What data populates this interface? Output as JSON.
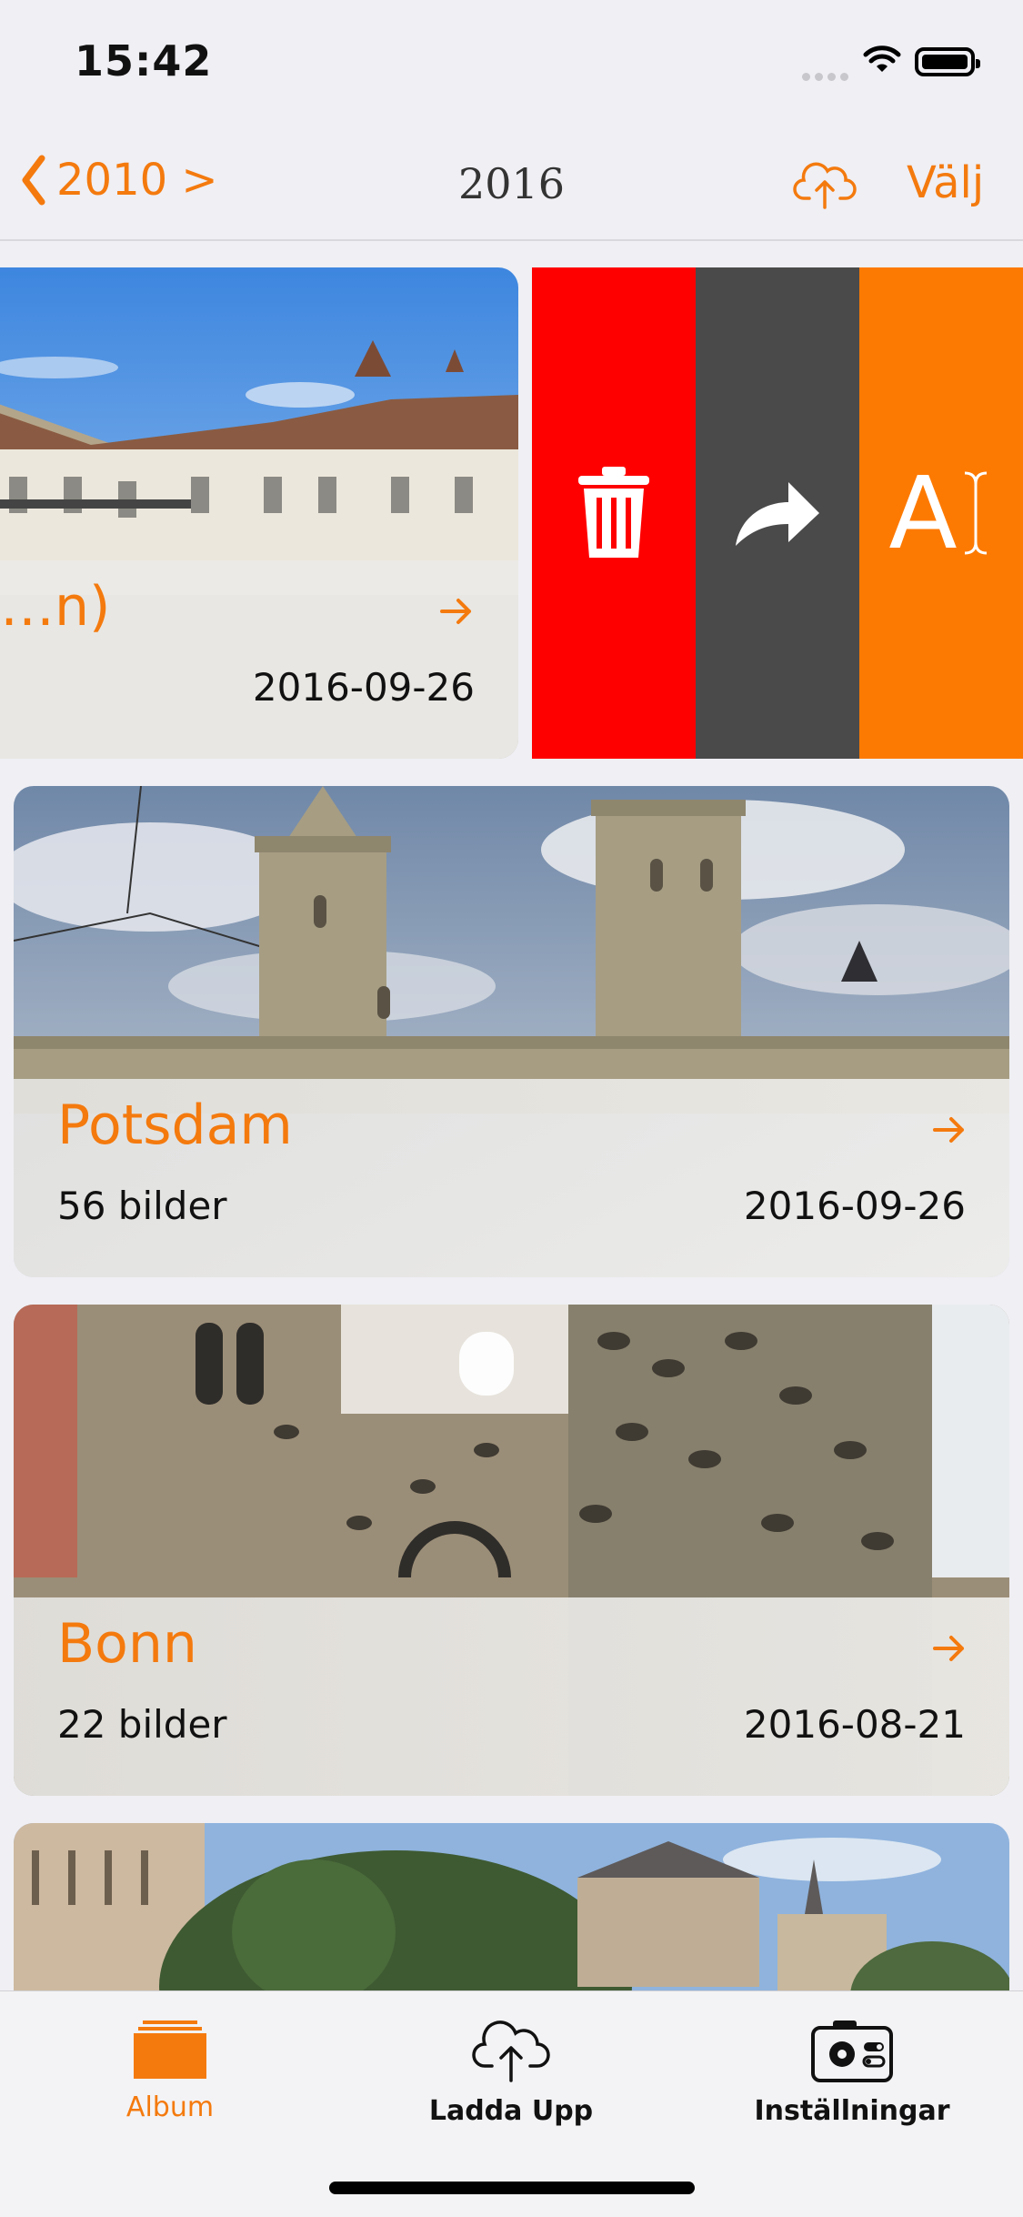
{
  "status_bar": {
    "time": "15:42"
  },
  "nav": {
    "back_label": "2010 >",
    "title": "2016",
    "upload_icon": "cloud-upload-icon",
    "select_label": "Välj"
  },
  "albums": [
    {
      "title": "…n)",
      "count": "",
      "date": "2016-09-26"
    },
    {
      "title": "Potsdam",
      "count": "56 bilder",
      "date": "2016-09-26"
    },
    {
      "title": "Bonn",
      "count": "22 bilder",
      "date": "2016-08-21"
    }
  ],
  "swipe_actions": {
    "delete_icon": "trash-icon",
    "share_icon": "share-arrow-icon",
    "rename_label": "A",
    "colors": {
      "delete": "#fe0000",
      "share": "#4a4a4a",
      "rename": "#fd7a02"
    }
  },
  "tabbar": {
    "tabs": [
      {
        "label": "Album",
        "icon": "album-stack-icon",
        "active": true
      },
      {
        "label": "Ladda Upp",
        "icon": "cloud-upload-icon",
        "active": false
      },
      {
        "label": "Inställningar",
        "icon": "settings-camera-icon",
        "active": false
      }
    ]
  },
  "colors": {
    "accent": "#f47a0e",
    "background": "#efeff4"
  }
}
